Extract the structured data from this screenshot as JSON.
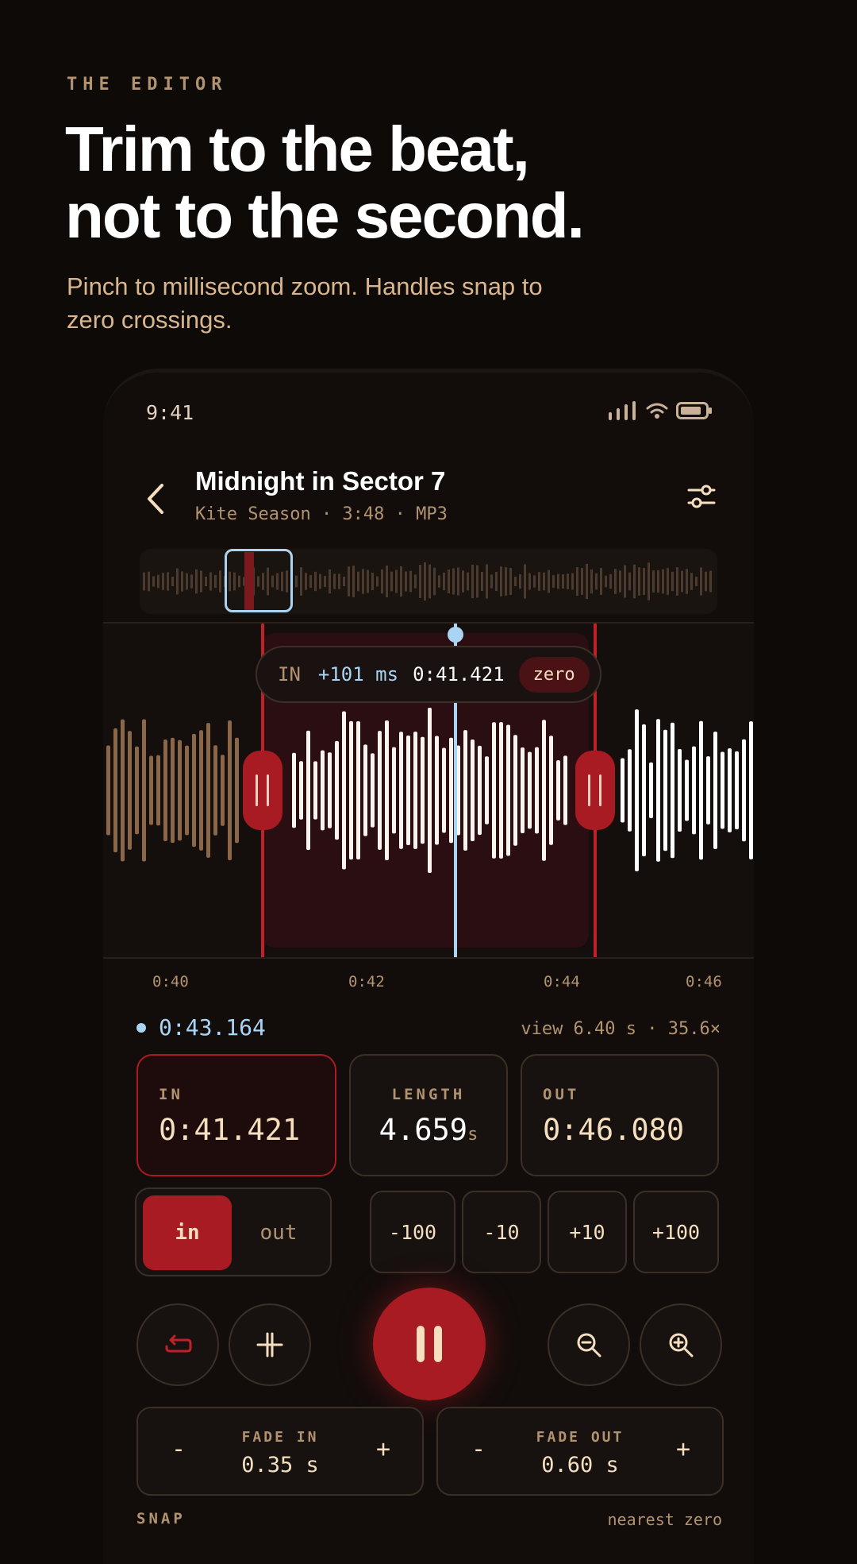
{
  "hero": {
    "eyebrow": "THE EDITOR",
    "title_line1": "Trim to the beat,",
    "title_line2": "not to the second.",
    "subtitle": "Pinch to millisecond zoom. Handles snap to zero crossings."
  },
  "status_bar": {
    "time": "9:41",
    "icons": [
      "signal-icon",
      "wifi-icon",
      "battery-icon"
    ]
  },
  "track": {
    "title": "Midnight in Sector 7",
    "meta": "Kite Season · 3:48 · MP3"
  },
  "tooltip": {
    "label": "IN",
    "delta": "+101 ms",
    "time": "0:41.421",
    "snap": "zero"
  },
  "ticks": [
    "0:40",
    "0:42",
    "0:44",
    "0:46"
  ],
  "playhead": {
    "time": "0:43.164",
    "view": "view 6.40 s · 35.6×"
  },
  "cards": {
    "in_label": "IN",
    "in_value": "0:41.421",
    "length_label": "LENGTH",
    "length_value": "4.659",
    "length_unit": "s",
    "out_label": "OUT",
    "out_value": "0:46.080"
  },
  "segment": {
    "in": "in",
    "out": "out",
    "selected": "in"
  },
  "nudges": [
    "-100",
    "-10",
    "+10",
    "+100"
  ],
  "fade_in": {
    "label": "FADE IN",
    "value": "0.35 s",
    "minus": "-",
    "plus": "+"
  },
  "fade_out": {
    "label": "FADE OUT",
    "value": "0.60 s",
    "minus": "-",
    "plus": "+"
  },
  "snap": {
    "label": "SNAP",
    "value": "nearest zero"
  },
  "colors": {
    "accent": "#a81b22",
    "playhead": "#a9d4f4",
    "muted": "#b29370",
    "cream": "#f5dfbf",
    "background": "#0e0a08"
  }
}
